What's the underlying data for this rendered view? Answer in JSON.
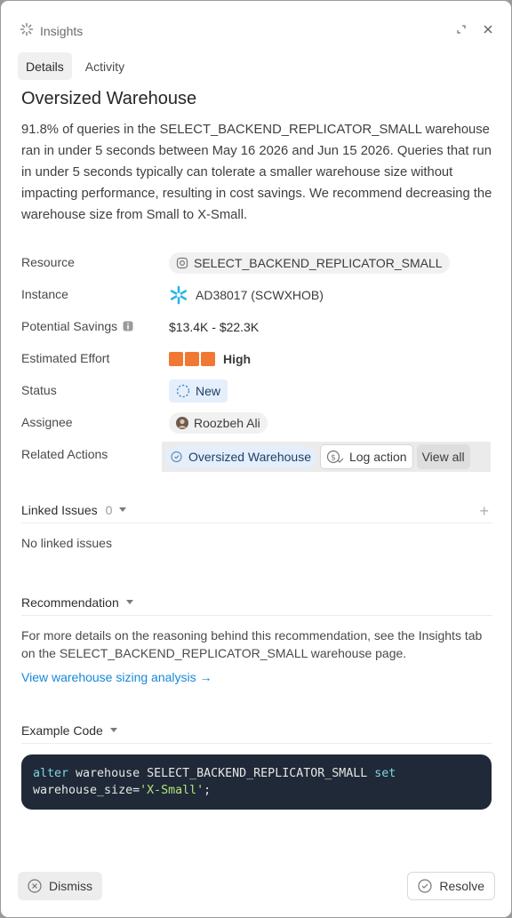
{
  "header": {
    "title": "Insights"
  },
  "tabs": [
    {
      "label": "Details",
      "active": true
    },
    {
      "label": "Activity",
      "active": false
    }
  ],
  "insight": {
    "title": "Oversized Warehouse",
    "description": "91.8% of queries in the SELECT_BACKEND_REPLICATOR_SMALL warehouse ran in under 5 seconds between May 16 2026 and Jun 15 2026. Queries that run in under 5 seconds typically can tolerate a smaller warehouse size without impacting performance, resulting in cost savings. We recommend decreasing the warehouse size from Small to X-Small."
  },
  "properties": {
    "resource_label": "Resource",
    "resource_value": "SELECT_BACKEND_REPLICATOR_SMALL",
    "instance_label": "Instance",
    "instance_value": "AD38017 (SCWXHOB)",
    "savings_label": "Potential Savings",
    "savings_value": "$13.4K - $22.3K",
    "effort_label": "Estimated Effort",
    "effort_value": "High",
    "effort_level": 3,
    "effort_max": 3,
    "status_label": "Status",
    "status_value": "New",
    "assignee_label": "Assignee",
    "assignee_value": "Roozbeh Ali",
    "related_label": "Related Actions",
    "related_chip": "Oversized Warehouse",
    "log_action": "Log action",
    "view_all": "View all"
  },
  "linked_issues": {
    "title": "Linked Issues",
    "count": "0",
    "empty": "No linked issues"
  },
  "recommendation": {
    "title": "Recommendation",
    "text": "For more details on the reasoning behind this recommendation, see the Insights tab on the SELECT_BACKEND_REPLICATOR_SMALL warehouse page.",
    "link": "View warehouse sizing analysis →"
  },
  "example_code": {
    "title": "Example Code",
    "kw1": "alter",
    "t1": " warehouse SELECT_BACKEND_REPLICATOR_SMALL ",
    "kw2": "set",
    "t2": "warehouse_size=",
    "str": "'X-Small'",
    "t3": ";"
  },
  "footer": {
    "dismiss": "Dismiss",
    "resolve": "Resolve"
  },
  "colors": {
    "accent_link": "#1688d8",
    "effort": "#f07832",
    "snowflake": "#29b5e8",
    "code_bg": "#1f2937"
  }
}
